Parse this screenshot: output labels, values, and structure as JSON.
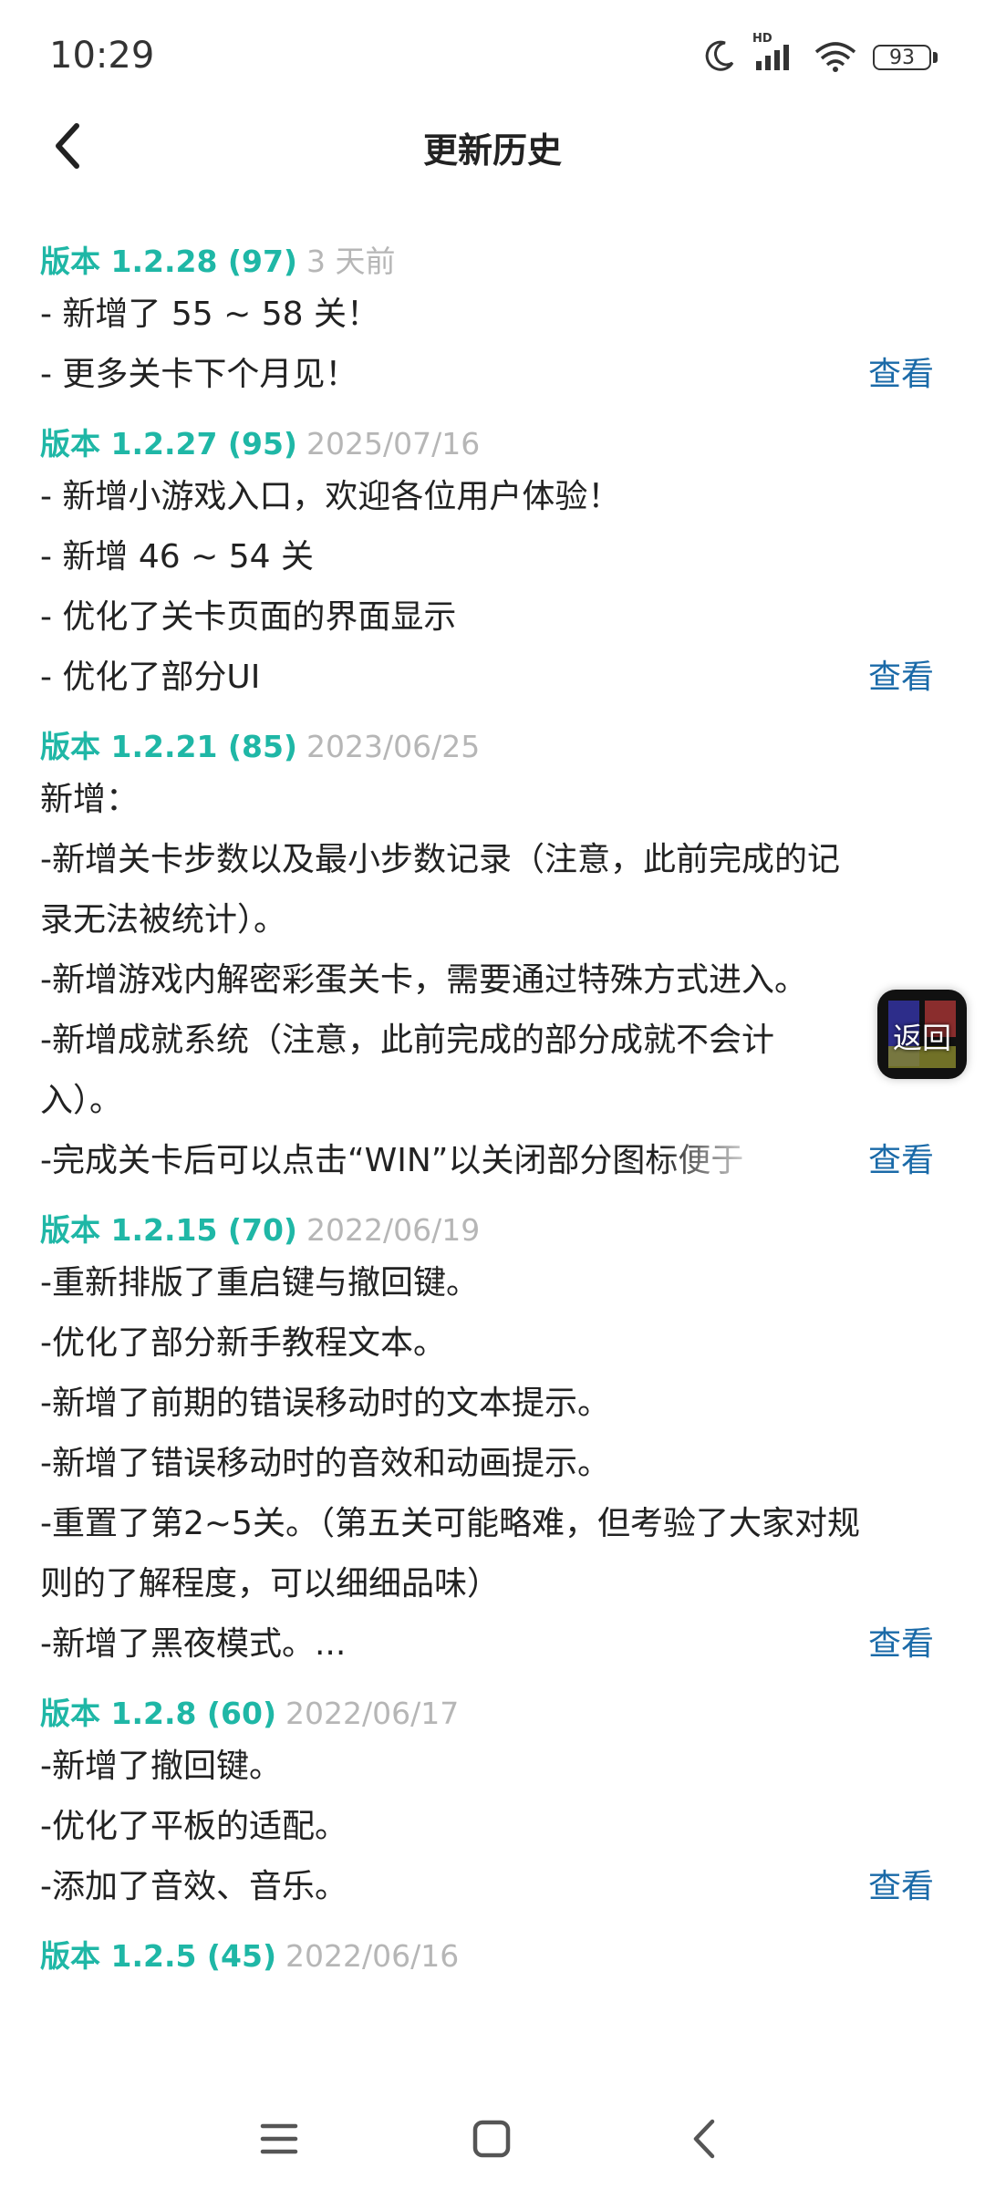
{
  "status_bar": {
    "time": "10:29",
    "battery": "93",
    "network_badge": "HD"
  },
  "header": {
    "title": "更新历史"
  },
  "accent_color": "#1fb7a6",
  "link_color": "#1a6aa8",
  "view_label": "查看",
  "float_button": {
    "label": "返回"
  },
  "entries": [
    {
      "version": "版本 1.2.28 (97)",
      "date": "3 天前",
      "lines": [
        "- 新增了 55 ~ 58 关！",
        "- 更多关卡下个月见！"
      ]
    },
    {
      "version": "版本 1.2.27 (95)",
      "date": "2025/07/16",
      "lines": [
        "- 新增小游戏入口，欢迎各位用户体验！",
        "- 新增 46 ~ 54 关",
        "- 优化了关卡页面的界面显示",
        "- 优化了部分UI"
      ]
    },
    {
      "version": "版本 1.2.21 (85)",
      "date": "2023/06/25",
      "lines": [
        "新增：",
        "-新增关卡步数以及最小步数记录（注意，此前完成的记",
        "录无法被统计）。",
        "-新增游戏内解密彩蛋关卡，需要通过特殊方式进入。",
        "-新增成就系统（注意，此前完成的部分成就不会计",
        "入）。",
        "-完成关卡后可以点击“WIN”以关闭部分图标便于"
      ]
    },
    {
      "version": "版本 1.2.15 (70)",
      "date": "2022/06/19",
      "lines": [
        "-重新排版了重启键与撤回键。",
        "-优化了部分新手教程文本。",
        "-新增了前期的错误移动时的文本提示。",
        "-新增了错误移动时的音效和动画提示。",
        "-重置了第2~5关。（第五关可能略难，但考验了大家对规",
        "则的了解程度，可以细细品味）",
        "-新增了黑夜模式。..."
      ]
    },
    {
      "version": "版本 1.2.8 (60)",
      "date": "2022/06/17",
      "lines": [
        "-新增了撤回键。",
        "-优化了平板的适配。",
        "-添加了音效、音乐。"
      ]
    },
    {
      "version": "版本 1.2.5 (45)",
      "date": "2022/06/16",
      "lines": []
    }
  ]
}
